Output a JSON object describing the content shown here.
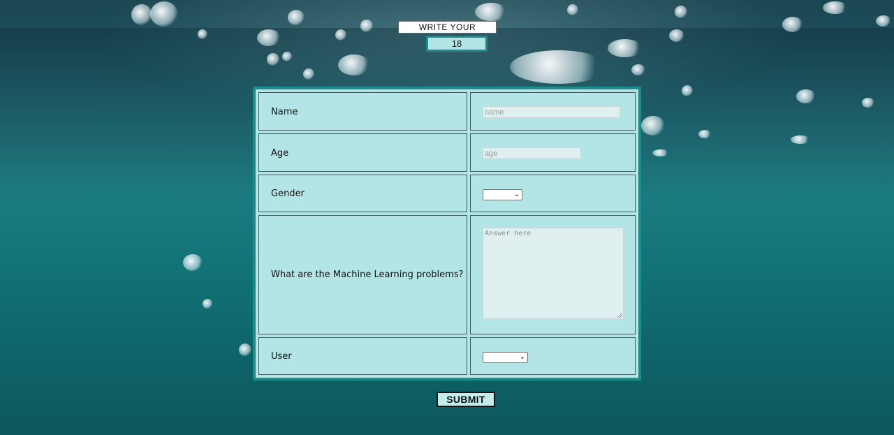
{
  "header": {
    "instruction_label": "WRITE YOUR ANSWER",
    "counter_value": "18"
  },
  "form": {
    "rows": [
      {
        "label": "Name",
        "input_placeholder": "name"
      },
      {
        "label": "Age",
        "input_placeholder": "age"
      },
      {
        "label": "Gender",
        "select_value": ""
      },
      {
        "label": "What are the Machine Learning problems?",
        "textarea_placeholder": "Answer here"
      },
      {
        "label": "User",
        "select_value": ""
      }
    ],
    "submit_label": "SUBMIT"
  },
  "colors": {
    "form_background": "#b3e5e6",
    "form_border": "#1e8c8c",
    "field_background": "#e0f0f0"
  },
  "icons": [
    "chevron-down-icon",
    "resize-grip-icon"
  ]
}
